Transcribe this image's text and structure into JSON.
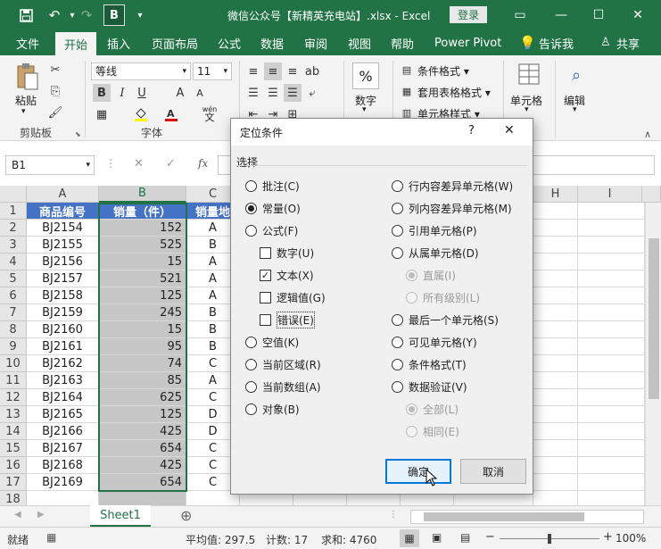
{
  "titlebar": {
    "save_icon": "save-icon",
    "undo_icon": "undo-icon",
    "redo_icon": "redo-icon",
    "bold_quick": "B",
    "title": "微信公众号【新精英充电站】.xlsx  -  Excel",
    "login": "登录",
    "controls": {
      "ribbon_display": "▭",
      "minimize": "—",
      "maximize": "☐",
      "close": "✕"
    }
  },
  "menu": {
    "tabs": [
      "文件",
      "开始",
      "插入",
      "页面布局",
      "公式",
      "数据",
      "审阅",
      "视图",
      "帮助",
      "Power Pivot"
    ],
    "tell_me": "告诉我",
    "share": "共享"
  },
  "ribbon": {
    "clipboard": {
      "paste": "粘贴",
      "label": "剪贴板"
    },
    "font": {
      "name": "等线",
      "size": "11",
      "bold": "B",
      "italic": "I",
      "underline": "U",
      "grow": "A",
      "shrink": "A",
      "label": "字体",
      "wen": "wén",
      "wen2": "文"
    },
    "number": {
      "label": "数字",
      "percent": "%"
    },
    "styles": {
      "conditional": "条件格式",
      "table": "套用表格格式",
      "cell_styles": "单元格样式"
    },
    "cells": {
      "label": "单元格"
    },
    "editing": {
      "label": "编辑"
    }
  },
  "formula_bar": {
    "name_box": "B1",
    "cancel": "✕",
    "enter": "✓",
    "fx": "fx"
  },
  "grid": {
    "columns": [
      "A",
      "B",
      "C",
      "",
      "",
      "",
      "H",
      "I"
    ],
    "rows": [
      "1",
      "2",
      "3",
      "4",
      "5",
      "6",
      "7",
      "8",
      "9",
      "10",
      "11",
      "12",
      "13",
      "14",
      "15",
      "16",
      "17",
      "18"
    ],
    "headers": [
      "商品编号",
      "销量（件）",
      "销量地"
    ],
    "data": [
      [
        "BJ2154",
        "152",
        "A"
      ],
      [
        "BJ2155",
        "525",
        "B"
      ],
      [
        "BJ2156",
        "15",
        "A"
      ],
      [
        "BJ2157",
        "521",
        "A"
      ],
      [
        "BJ2158",
        "125",
        "A"
      ],
      [
        "BJ2159",
        "245",
        "B"
      ],
      [
        "BJ2160",
        "15",
        "B"
      ],
      [
        "BJ2161",
        "95",
        "B"
      ],
      [
        "BJ2162",
        "74",
        "C"
      ],
      [
        "BJ2163",
        "85",
        "A"
      ],
      [
        "BJ2164",
        "625",
        "C"
      ],
      [
        "BJ2165",
        "125",
        "D"
      ],
      [
        "BJ2166",
        "425",
        "D"
      ],
      [
        "BJ2167",
        "654",
        "C"
      ],
      [
        "BJ2168",
        "425",
        "C"
      ],
      [
        "BJ2169",
        "654",
        "C"
      ]
    ]
  },
  "sheets": {
    "active": "Sheet1",
    "add": "⊕"
  },
  "status": {
    "mode": "就绪",
    "average": "平均值: 297.5",
    "count": "计数: 17",
    "sum": "求和: 4760",
    "zoom": "100%"
  },
  "dialog": {
    "title": "定位条件",
    "help": "?",
    "close": "✕",
    "section": "选择",
    "left_options": [
      {
        "label": "批注(C)",
        "type": "radio",
        "checked": false,
        "disabled": false
      },
      {
        "label": "常量(O)",
        "type": "radio",
        "checked": true,
        "disabled": false
      },
      {
        "label": "公式(F)",
        "type": "radio",
        "checked": false,
        "disabled": false
      },
      {
        "label": "数字(U)",
        "type": "check",
        "checked": false,
        "disabled": false
      },
      {
        "label": "文本(X)",
        "type": "check",
        "checked": true,
        "disabled": false
      },
      {
        "label": "逻辑值(G)",
        "type": "check",
        "checked": false,
        "disabled": false
      },
      {
        "label": "错误(E)",
        "type": "check",
        "checked": false,
        "disabled": false
      },
      {
        "label": "空值(K)",
        "type": "radio",
        "checked": false,
        "disabled": false
      },
      {
        "label": "当前区域(R)",
        "type": "radio",
        "checked": false,
        "disabled": false
      },
      {
        "label": "当前数组(A)",
        "type": "radio",
        "checked": false,
        "disabled": false
      },
      {
        "label": "对象(B)",
        "type": "radio",
        "checked": false,
        "disabled": false
      }
    ],
    "right_options": [
      {
        "label": "行内容差异单元格(W)",
        "type": "radio",
        "checked": false,
        "disabled": false
      },
      {
        "label": "列内容差异单元格(M)",
        "type": "radio",
        "checked": false,
        "disabled": false
      },
      {
        "label": "引用单元格(P)",
        "type": "radio",
        "checked": false,
        "disabled": false
      },
      {
        "label": "从属单元格(D)",
        "type": "radio",
        "checked": false,
        "disabled": false
      },
      {
        "label": "直属(I)",
        "type": "radio",
        "checked": true,
        "disabled": true
      },
      {
        "label": "所有级别(L)",
        "type": "radio",
        "checked": false,
        "disabled": true
      },
      {
        "label": "最后一个单元格(S)",
        "type": "radio",
        "checked": false,
        "disabled": false
      },
      {
        "label": "可见单元格(Y)",
        "type": "radio",
        "checked": false,
        "disabled": false
      },
      {
        "label": "条件格式(T)",
        "type": "radio",
        "checked": false,
        "disabled": false
      },
      {
        "label": "数据验证(V)",
        "type": "radio",
        "checked": false,
        "disabled": false
      },
      {
        "label": "全部(L)",
        "type": "radio",
        "checked": true,
        "disabled": true
      },
      {
        "label": "相同(E)",
        "type": "radio",
        "checked": false,
        "disabled": true
      }
    ],
    "ok": "确定",
    "cancel": "取消"
  }
}
